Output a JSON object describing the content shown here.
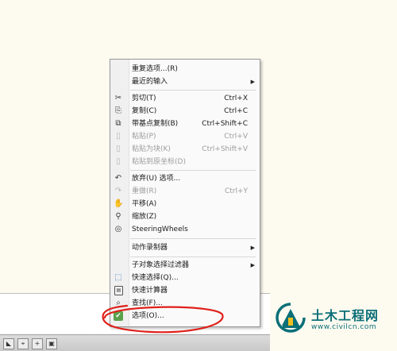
{
  "menu": {
    "items": [
      {
        "label": "重复选项...(R)",
        "shortcut": "",
        "icon": "",
        "submenu": false,
        "disabled": false
      },
      {
        "label": "最近的输入",
        "shortcut": "",
        "icon": "",
        "submenu": true,
        "disabled": false
      },
      {
        "label": "剪切(T)",
        "shortcut": "Ctrl+X",
        "icon": "✂",
        "submenu": false,
        "disabled": false
      },
      {
        "label": "复制(C)",
        "shortcut": "Ctrl+C",
        "icon": "⎘",
        "submenu": false,
        "disabled": false
      },
      {
        "label": "带基点复制(B)",
        "shortcut": "Ctrl+Shift+C",
        "icon": "⧉",
        "submenu": false,
        "disabled": false
      },
      {
        "label": "粘贴(P)",
        "shortcut": "Ctrl+V",
        "icon": "▯",
        "submenu": false,
        "disabled": true
      },
      {
        "label": "粘贴为块(K)",
        "shortcut": "Ctrl+Shift+V",
        "icon": "▯",
        "submenu": false,
        "disabled": true
      },
      {
        "label": "粘贴到原坐标(D)",
        "shortcut": "",
        "icon": "▯",
        "submenu": false,
        "disabled": true
      },
      {
        "label": "放弃(U) 选项...",
        "shortcut": "",
        "icon": "↶",
        "submenu": false,
        "disabled": false
      },
      {
        "label": "重做(R)",
        "shortcut": "Ctrl+Y",
        "icon": "↷",
        "submenu": false,
        "disabled": true
      },
      {
        "label": "平移(A)",
        "shortcut": "",
        "icon": "✋",
        "submenu": false,
        "disabled": false
      },
      {
        "label": "缩放(Z)",
        "shortcut": "",
        "icon": "⚲",
        "submenu": false,
        "disabled": false
      },
      {
        "label": "SteeringWheels",
        "shortcut": "",
        "icon": "◎",
        "submenu": false,
        "disabled": false
      },
      {
        "label": "动作录制器",
        "shortcut": "",
        "icon": "",
        "submenu": true,
        "disabled": false
      },
      {
        "label": "子对象选择过滤器",
        "shortcut": "",
        "icon": "",
        "submenu": true,
        "disabled": false
      },
      {
        "label": "快速选择(Q)...",
        "shortcut": "",
        "icon": "⬚",
        "submenu": false,
        "disabled": false
      },
      {
        "label": "快速计算器",
        "shortcut": "",
        "icon": "▤",
        "submenu": false,
        "disabled": false
      },
      {
        "label": "查找(F)...",
        "shortcut": "",
        "icon": "⌕",
        "submenu": false,
        "disabled": false
      },
      {
        "label": "选项(O)...",
        "shortcut": "",
        "icon": "✔",
        "submenu": false,
        "disabled": false
      }
    ],
    "submenu_arrow": "▶"
  },
  "status_bar": {
    "buttons": [
      "◣",
      "⌖",
      "+",
      "▣"
    ]
  },
  "watermark": {
    "brand": "土木工程网",
    "url": "www.civilcn.com",
    "color": "#0b6f78"
  },
  "colors": {
    "annotation": "#e0201a",
    "menu_bg": "#fafafa",
    "page_bg": "#fdfaf0"
  }
}
